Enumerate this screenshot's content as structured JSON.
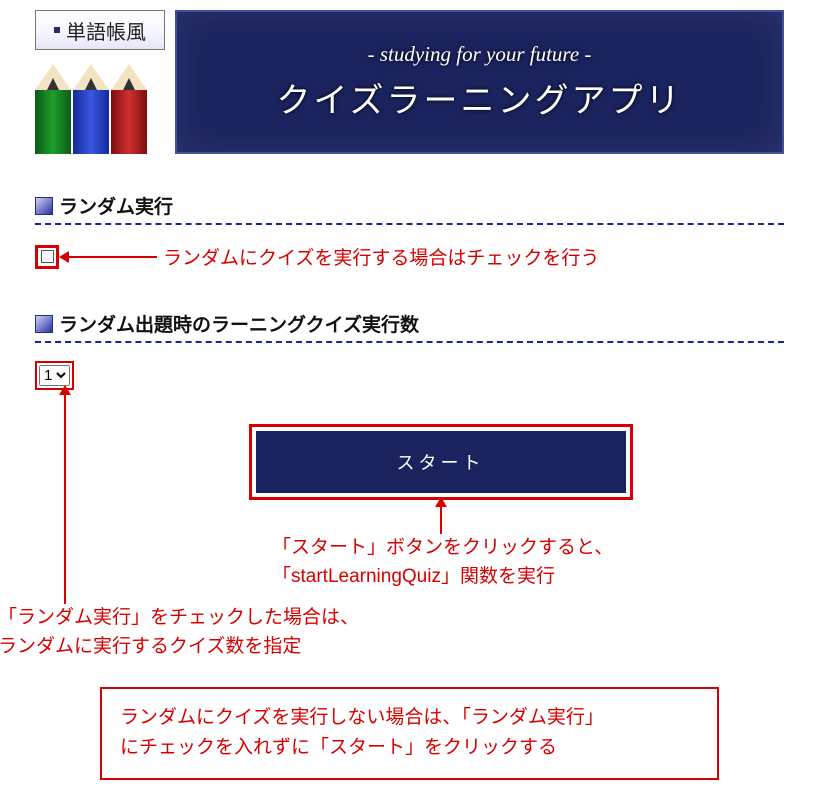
{
  "header": {
    "badge": "単語帳風",
    "subtitle": "- studying for your future -",
    "title": "クイズラーニングアプリ"
  },
  "section_random": {
    "heading": "ランダム実行",
    "annotation": "ランダムにクイズを実行する場合はチェックを行う"
  },
  "section_count": {
    "heading": "ランダム出題時のラーニングクイズ実行数",
    "selected": "1",
    "annotation_line1": "「ランダム実行」をチェックした場合は、",
    "annotation_line2": "ランダムに実行するクイズ数を指定"
  },
  "start": {
    "label": "スタート",
    "annotation_line1": "「スタート」ボタンをクリックすると、",
    "annotation_line2": "「startLearningQuiz」関数を実行"
  },
  "note": {
    "line1": "ランダムにクイズを実行しない場合は、「ランダム実行」",
    "line2": "にチェックを入れずに「スタート」をクリックする"
  }
}
